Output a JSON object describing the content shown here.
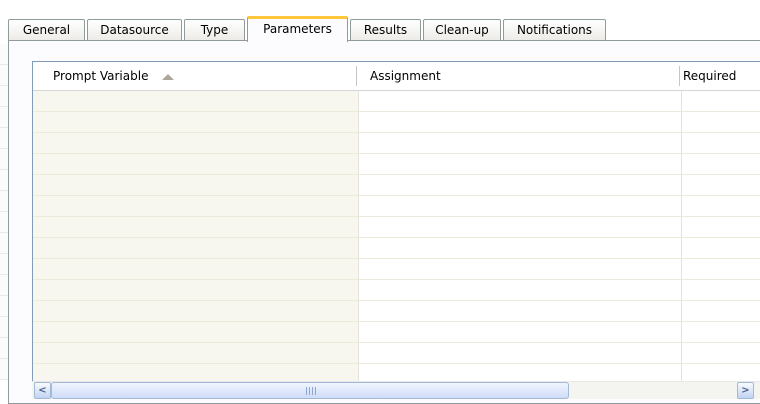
{
  "tabs": [
    {
      "label": "General",
      "active": false
    },
    {
      "label": "Datasource",
      "active": false
    },
    {
      "label": "Type",
      "active": false
    },
    {
      "label": "Parameters",
      "active": true
    },
    {
      "label": "Results",
      "active": false
    },
    {
      "label": "Clean-up",
      "active": false
    },
    {
      "label": "Notifications",
      "active": false
    }
  ],
  "table": {
    "columns": [
      "Prompt Variable",
      "Assignment",
      "Required"
    ],
    "sort": {
      "column": "Prompt Variable",
      "direction": "ascending"
    },
    "row_count": 0
  },
  "scrollbar": {
    "left_arrow": "<",
    "right_arrow": ">"
  },
  "colors": {
    "active_tab_accent": "#ffc83c",
    "tab_border": "#919b9c",
    "first_column_bg": "#f7f6ef",
    "scrollbar": "#c2d3f3"
  }
}
